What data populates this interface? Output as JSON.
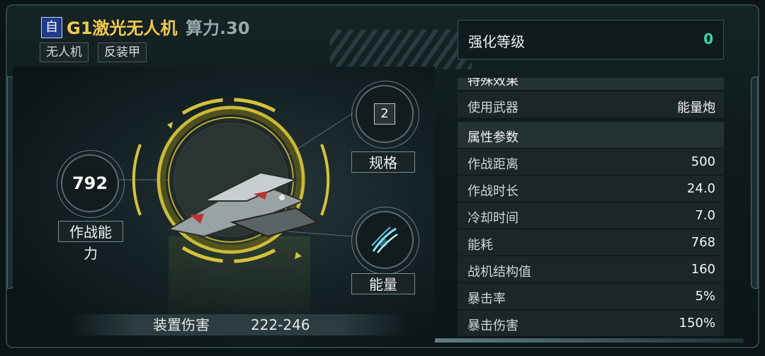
{
  "header": {
    "self_badge": "自",
    "title": "G1激光无人机",
    "power": "算力.30",
    "tags": [
      "无人机",
      "反装甲"
    ]
  },
  "stats": {
    "combat_value": "792",
    "combat_label": "作战能力",
    "spec_value": "2",
    "spec_label": "规格",
    "energy_label": "能量",
    "energy_icon": "energy-claw-icon"
  },
  "damage": {
    "label": "装置伤害",
    "value": "222-246"
  },
  "enhance": {
    "label": "强化等级",
    "value": "0"
  },
  "attributes": {
    "special_effects_heading": "特殊效果",
    "weapon_label": "使用武器",
    "weapon_value": "能量炮",
    "params_heading": "属性参数",
    "rows": [
      {
        "k": "作战距离",
        "v": "500"
      },
      {
        "k": "作战时长",
        "v": "24.0"
      },
      {
        "k": "冷却时间",
        "v": "7.0"
      },
      {
        "k": "能耗",
        "v": "768"
      },
      {
        "k": "战机结构值",
        "v": "160"
      },
      {
        "k": "暴击率",
        "v": "5%"
      },
      {
        "k": "暴击伤害",
        "v": "150%"
      }
    ]
  },
  "colors": {
    "title_gold": "#f2c94c",
    "enhance_green": "#36d7a6",
    "ring_gold": "#d4c23a"
  }
}
